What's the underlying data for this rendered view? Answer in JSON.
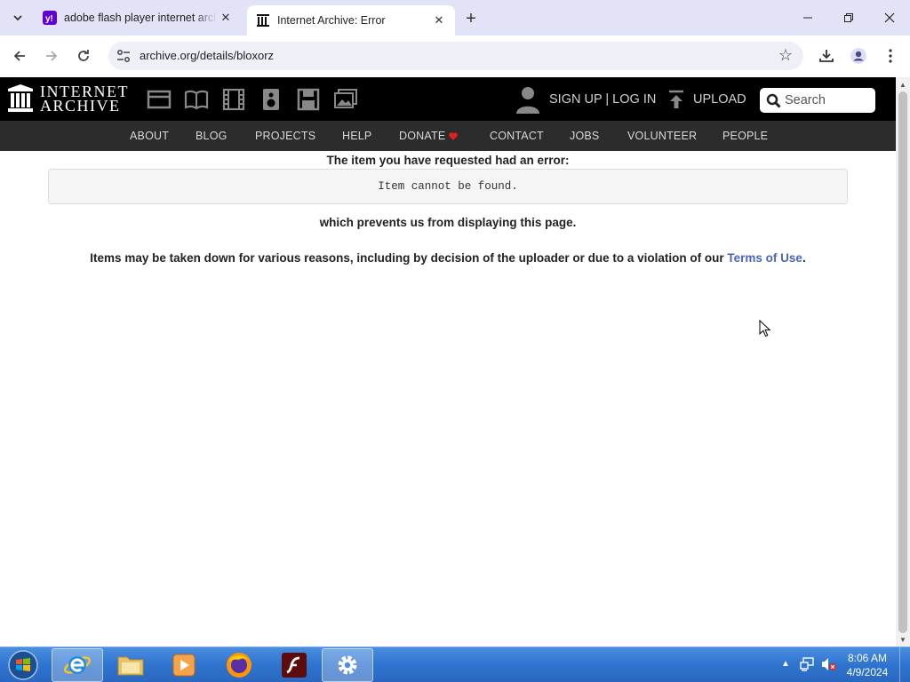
{
  "browser": {
    "tabs": [
      {
        "title": "adobe flash player internet archive",
        "favicon": "yahoo-icon",
        "active": false
      },
      {
        "title": "Internet Archive: Error",
        "favicon": "archive-icon",
        "active": true
      }
    ],
    "url": "archive.org/details/bloxorz"
  },
  "ia_header": {
    "logo_line1": "INTERNET",
    "logo_line2": "ARCHIVE",
    "media_icons": [
      "web-icon",
      "texts-icon",
      "video-icon",
      "audio-icon",
      "software-icon",
      "images-icon"
    ],
    "signup_login": "SIGN UP | LOG IN",
    "upload": "UPLOAD",
    "search_placeholder": "Search"
  },
  "ia_nav": {
    "items": [
      "ABOUT",
      "BLOG",
      "PROJECTS",
      "HELP",
      "DONATE",
      "CONTACT",
      "JOBS",
      "VOLUNTEER",
      "PEOPLE"
    ]
  },
  "error": {
    "heading": "The item you have requested had an error:",
    "code": "Item cannot be found.",
    "prevents": "which prevents us from displaying this page.",
    "reason_prefix": "Items may be taken down for various reasons, including by decision of the uploader or due to a violation of our ",
    "reason_link": "Terms of Use",
    "reason_suffix": "."
  },
  "taskbar": {
    "time": "8:06 AM",
    "date": "4/9/2024"
  },
  "colors": {
    "ia_black": "#000000",
    "ia_nav": "#2c2c2c",
    "link": "#4b64be",
    "donate_heart": "#e02020",
    "taskbar": "#2f74cf"
  }
}
